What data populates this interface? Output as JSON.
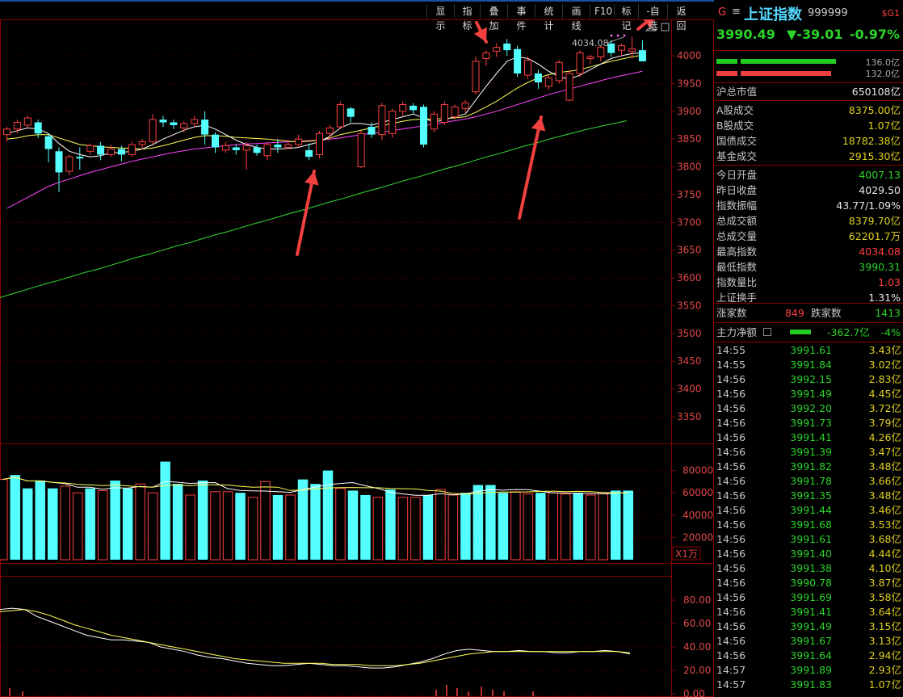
{
  "toolbar": {
    "buttons": [
      "显示",
      "指标",
      "叠加",
      "事件",
      "统计",
      "画线",
      "F10",
      "标记",
      "-自选",
      "返回"
    ]
  },
  "colors": {
    "up": "#ff4040",
    "down": "#54ffff",
    "ma5": "#ffffff",
    "ma10": "#ffff55",
    "ma20": "#ff44ff",
    "ma60": "#33dd33",
    "grid": "#8b0000",
    "accent": "#2bd32b"
  },
  "chart_data": [
    {
      "type": "candlestick",
      "ylim": [
        3290,
        4090
      ],
      "y_ticks": [
        "4000",
        "3950",
        "3900",
        "3850",
        "3800",
        "3750",
        "3700",
        "3650",
        "3600",
        "3550",
        "3500",
        "3450",
        "3400",
        "3350"
      ],
      "annotation": "4034.08",
      "candles": [
        [
          3858,
          3868,
          3845,
          3872
        ],
        [
          3868,
          3880,
          3860,
          3885
        ],
        [
          3875,
          3888,
          3868,
          3892
        ],
        [
          3880,
          3860,
          3852,
          3885
        ],
        [
          3855,
          3832,
          3808,
          3860
        ],
        [
          3828,
          3790,
          3755,
          3835
        ],
        [
          3792,
          3818,
          3785,
          3822
        ],
        [
          3818,
          3815,
          3795,
          3835
        ],
        [
          3828,
          3838,
          3822,
          3842
        ],
        [
          3838,
          3822,
          3812,
          3845
        ],
        [
          3822,
          3832,
          3818,
          3840
        ],
        [
          3832,
          3822,
          3810,
          3838
        ],
        [
          3822,
          3840,
          3818,
          3845
        ],
        [
          3840,
          3845,
          3832,
          3850
        ],
        [
          3845,
          3885,
          3840,
          3895
        ],
        [
          3885,
          3880,
          3872,
          3892
        ],
        [
          3880,
          3875,
          3868,
          3885
        ],
        [
          3870,
          3878,
          3862,
          3882
        ],
        [
          3878,
          3885,
          3872,
          3892
        ],
        [
          3885,
          3858,
          3840,
          3900
        ],
        [
          3858,
          3835,
          3825,
          3862
        ],
        [
          3830,
          3838,
          3825,
          3845
        ],
        [
          3835,
          3830,
          3822,
          3840
        ],
        [
          3830,
          3838,
          3795,
          3845
        ],
        [
          3835,
          3825,
          3820,
          3840
        ],
        [
          3820,
          3840,
          3812,
          3845
        ],
        [
          3840,
          3835,
          3825,
          3850
        ],
        [
          3835,
          3840,
          3832,
          3848
        ],
        [
          3840,
          3850,
          3835,
          3858
        ],
        [
          3830,
          3818,
          3812,
          3842
        ],
        [
          3822,
          3860,
          3815,
          3865
        ],
        [
          3860,
          3870,
          3848,
          3875
        ],
        [
          3872,
          3912,
          3868,
          3918
        ],
        [
          3905,
          3890,
          3880,
          3908
        ],
        [
          3800,
          3860,
          3798,
          3865
        ],
        [
          3872,
          3858,
          3852,
          3880
        ],
        [
          3858,
          3910,
          3848,
          3915
        ],
        [
          3860,
          3900,
          3852,
          3905
        ],
        [
          3900,
          3912,
          3892,
          3918
        ],
        [
          3910,
          3902,
          3895,
          3915
        ],
        [
          3908,
          3840,
          3835,
          3912
        ],
        [
          3868,
          3895,
          3862,
          3900
        ],
        [
          3880,
          3912,
          3875,
          3918
        ],
        [
          3890,
          3908,
          3885,
          3912
        ],
        [
          3905,
          3915,
          3898,
          3920
        ],
        [
          3935,
          3990,
          3930,
          3998
        ],
        [
          3995,
          4005,
          3982,
          4010
        ],
        [
          4008,
          4015,
          3998,
          4022
        ],
        [
          4022,
          4010,
          4000,
          4030
        ],
        [
          4012,
          3968,
          3962,
          4018
        ],
        [
          3965,
          3992,
          3958,
          3998
        ],
        [
          3968,
          3952,
          3940,
          3975
        ],
        [
          3945,
          3960,
          3938,
          3965
        ],
        [
          3955,
          3988,
          3950,
          3992
        ],
        [
          3920,
          3968,
          3918,
          3975
        ],
        [
          3968,
          4005,
          3962,
          4010
        ],
        [
          3995,
          3998,
          3985,
          4002
        ],
        [
          3998,
          4015,
          3990,
          4018
        ],
        [
          4022,
          4005,
          3998,
          4028
        ],
        [
          4010,
          4018,
          3998,
          4022
        ],
        [
          4008,
          4012,
          3995,
          4034
        ],
        [
          4010,
          3990,
          3990,
          4028
        ]
      ],
      "ma5": [
        3860,
        3865,
        3870,
        3868,
        3860,
        3842,
        3828,
        3822,
        3818,
        3820,
        3825,
        3826,
        3828,
        3832,
        3840,
        3850,
        3858,
        3866,
        3872,
        3875,
        3868,
        3858,
        3848,
        3840,
        3835,
        3832,
        3832,
        3833,
        3835,
        3840,
        3845,
        3855,
        3870,
        3878,
        3878,
        3875,
        3880,
        3885,
        3890,
        3895,
        3888,
        3880,
        3885,
        3890,
        3895,
        3920,
        3945,
        3968,
        3990,
        3998,
        3995,
        3985,
        3972,
        3962,
        3958,
        3965,
        3975,
        3985,
        3995,
        4000,
        4004,
        4005
      ],
      "ma10": [
        3850,
        3852,
        3856,
        3858,
        3858,
        3852,
        3846,
        3840,
        3838,
        3836,
        3835,
        3834,
        3833,
        3832,
        3834,
        3838,
        3843,
        3848,
        3853,
        3856,
        3856,
        3855,
        3853,
        3852,
        3851,
        3850,
        3848,
        3846,
        3845,
        3846,
        3848,
        3852,
        3858,
        3862,
        3866,
        3870,
        3874,
        3878,
        3882,
        3885,
        3886,
        3886,
        3887,
        3888,
        3890,
        3898,
        3908,
        3918,
        3930,
        3942,
        3952,
        3960,
        3966,
        3970,
        3972,
        3975,
        3980,
        3985,
        3990,
        3994,
        3998,
        4001
      ],
      "ma20": [
        3725,
        3735,
        3745,
        3755,
        3765,
        3772,
        3778,
        3784,
        3790,
        3795,
        3800,
        3805,
        3810,
        3814,
        3818,
        3822,
        3826,
        3829,
        3832,
        3834,
        3836,
        3838,
        3840,
        3841,
        3842,
        3843,
        3844,
        3845,
        3846,
        3847,
        3848,
        3850,
        3852,
        3855,
        3858,
        3860,
        3862,
        3865,
        3868,
        3871,
        3874,
        3877,
        3880,
        3883,
        3886,
        3890,
        3895,
        3900,
        3906,
        3912,
        3918,
        3924,
        3930,
        3935,
        3940,
        3945,
        3950,
        3955,
        3960,
        3964,
        3968,
        3972
      ],
      "ma60": [
        3562,
        3569,
        3576,
        3583,
        3590,
        3596,
        3603,
        3610,
        3616,
        3623,
        3630,
        3637,
        3643,
        3650,
        3657,
        3663,
        3670,
        3677,
        3683,
        3690,
        3697,
        3703,
        3710,
        3717,
        3723,
        3730,
        3737,
        3743,
        3750,
        3757,
        3763,
        3770,
        3777,
        3783,
        3790,
        3797,
        3803,
        3810,
        3817,
        3823,
        3830,
        3837,
        3843,
        3850,
        3856,
        3862,
        3868,
        3873,
        3878,
        3883
      ]
    },
    {
      "type": "bar",
      "ylim": [
        0,
        100000
      ],
      "y_ticks": [
        "80000",
        "60000",
        "40000",
        "20000"
      ],
      "unit": "X1万",
      "values": [
        72000,
        76000,
        64000,
        71000,
        64000,
        66000,
        60000,
        64000,
        62000,
        71000,
        64000,
        68000,
        60000,
        88000,
        68000,
        58000,
        71000,
        61000,
        61000,
        60000,
        56000,
        70000,
        58000,
        58000,
        72000,
        68000,
        80000,
        64000,
        62000,
        58000,
        56000,
        63000,
        56000,
        56000,
        58000,
        63000,
        58000,
        60000,
        67000,
        67000,
        60000,
        61000,
        59000,
        60000,
        60000,
        59000,
        60000,
        58000,
        59000,
        62000,
        62000
      ]
    },
    {
      "type": "line",
      "ylim": [
        0,
        90
      ],
      "y_ticks": [
        "80.00",
        "60.00",
        "40.00",
        "20.00",
        "0.00"
      ]
    }
  ],
  "price_axis_labels_note": "",
  "quote": {
    "flag": "G",
    "menu": "≡",
    "name": "上证指数",
    "code": "999999",
    "badge": "$G1",
    "price": "3990.49",
    "change": "▼-39.01",
    "pct": "-0.97%",
    "bar1_val": "136.0亿",
    "bar2_val": "132.0亿"
  },
  "stats1": [
    {
      "label": "沪总市值",
      "value": "650108亿",
      "color": "#e8e8e8"
    }
  ],
  "stats2": [
    {
      "label": "A股成交",
      "value": "8375.00亿",
      "color": "#e0d020"
    },
    {
      "label": "B股成交",
      "value": "1.07亿",
      "color": "#e0d020"
    },
    {
      "label": "国债成交",
      "value": "18782.38亿",
      "color": "#e0d020"
    },
    {
      "label": "基金成交",
      "value": "2915.30亿",
      "color": "#e0d020"
    }
  ],
  "stats3": [
    {
      "label": "今日开盘",
      "value": "4007.13",
      "color": "#2bd32b"
    },
    {
      "label": "昨日收盘",
      "value": "4029.50",
      "color": "#e8e8e8"
    },
    {
      "label": "指数振幅",
      "value": "43.77/1.09%",
      "color": "#e8e8e8"
    },
    {
      "label": "总成交额",
      "value": "8379.70亿",
      "color": "#e0d020"
    },
    {
      "label": "总成交量",
      "value": "62201.7万",
      "color": "#e0d020"
    },
    {
      "label": "最高指数",
      "value": "4034.08",
      "color": "#ff4040"
    },
    {
      "label": "最低指数",
      "value": "3990.31",
      "color": "#2bd32b"
    },
    {
      "label": "指数量比",
      "value": "1.03",
      "color": "#ff4040"
    },
    {
      "label": "上证换手",
      "value": "1.31%",
      "color": "#e8e8e8"
    }
  ],
  "breadth": {
    "up_label": "涨家数",
    "up_value": "849",
    "down_label": "跌家数",
    "down_value": "1413"
  },
  "flow": {
    "label": "主力净额",
    "value": "-362.7亿",
    "pct": "-4%"
  },
  "ticks": [
    [
      "14:55",
      "3991.61",
      "3.43亿"
    ],
    [
      "14:55",
      "3991.84",
      "3.02亿"
    ],
    [
      "14:56",
      "3992.15",
      "2.83亿"
    ],
    [
      "14:56",
      "3991.49",
      "4.45亿"
    ],
    [
      "14:56",
      "3992.20",
      "3.72亿"
    ],
    [
      "14:56",
      "3991.73",
      "3.79亿"
    ],
    [
      "14:56",
      "3991.41",
      "4.26亿"
    ],
    [
      "14:56",
      "3991.39",
      "3.47亿"
    ],
    [
      "14:56",
      "3991.82",
      "3.48亿"
    ],
    [
      "14:56",
      "3991.78",
      "3.66亿"
    ],
    [
      "14:56",
      "3991.35",
      "3.48亿"
    ],
    [
      "14:56",
      "3991.44",
      "3.46亿"
    ],
    [
      "14:56",
      "3991.68",
      "3.53亿"
    ],
    [
      "14:56",
      "3991.61",
      "3.68亿"
    ],
    [
      "14:56",
      "3991.40",
      "4.44亿"
    ],
    [
      "14:56",
      "3991.38",
      "4.10亿"
    ],
    [
      "14:56",
      "3990.78",
      "3.87亿"
    ],
    [
      "14:56",
      "3991.69",
      "3.58亿"
    ],
    [
      "14:56",
      "3991.41",
      "3.64亿"
    ],
    [
      "14:56",
      "3991.49",
      "3.15亿"
    ],
    [
      "14:56",
      "3991.67",
      "3.13亿"
    ],
    [
      "14:56",
      "3991.64",
      "2.94亿"
    ],
    [
      "14:57",
      "3991.89",
      "2.93亿"
    ],
    [
      "14:57",
      "3991.83",
      "1.07亿"
    ]
  ]
}
